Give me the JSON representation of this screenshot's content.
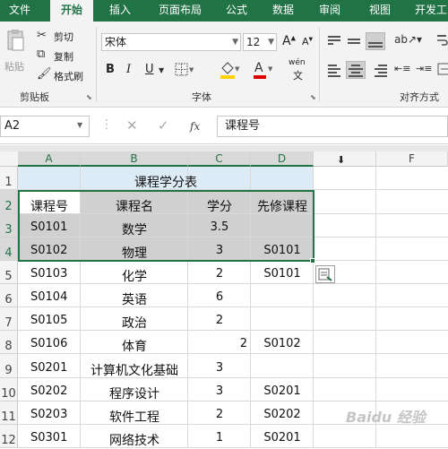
{
  "ribbon_tabs": [
    "文件",
    "开始",
    "插入",
    "页面布局",
    "公式",
    "数据",
    "审阅",
    "视图",
    "开发工"
  ],
  "clipboard": {
    "paste": "粘贴",
    "cut": "剪切",
    "copy": "复制",
    "format_painter": "格式刷",
    "group_label": "剪贴板"
  },
  "font": {
    "name": "宋体",
    "size": "12",
    "bold": "B",
    "italic": "I",
    "underline": "U",
    "grow": "A",
    "shrink": "A",
    "phonetic": "wén",
    "group_label": "字体"
  },
  "alignment": {
    "group_label": "对齐方式"
  },
  "formula_bar": {
    "name_box": "A2",
    "fx": "fx",
    "content": "课程号"
  },
  "columns": [
    "A",
    "B",
    "C",
    "D",
    "E",
    "F"
  ],
  "rows": [
    "1",
    "2",
    "3",
    "4",
    "5",
    "6",
    "7",
    "8",
    "9",
    "10",
    "11",
    "12"
  ],
  "sheet": {
    "title": "课程学分表",
    "headers": [
      "课程号",
      "课程名",
      "学分",
      "先修课程"
    ],
    "data": [
      [
        "S0101",
        "数学",
        "3.5",
        ""
      ],
      [
        "S0102",
        "物理",
        "3",
        "S0101"
      ],
      [
        "S0103",
        "化学",
        "2",
        "S0101"
      ],
      [
        "S0104",
        "英语",
        "6",
        ""
      ],
      [
        "S0105",
        "政治",
        "2",
        ""
      ],
      [
        "S0106",
        "体育",
        "2",
        "S0102"
      ],
      [
        "S0201",
        "计算机文化基础",
        "3",
        ""
      ],
      [
        "S0202",
        "程序设计",
        "3",
        "S0201"
      ],
      [
        "S0203",
        "软件工程",
        "2",
        "S0202"
      ],
      [
        "S0301",
        "网络技术",
        "1",
        "S0201"
      ]
    ]
  },
  "colors": {
    "excel_green": "#217346",
    "selection": "#d0d0d0",
    "title_fill": "#deebf7"
  },
  "watermark": "Baidu 经验"
}
